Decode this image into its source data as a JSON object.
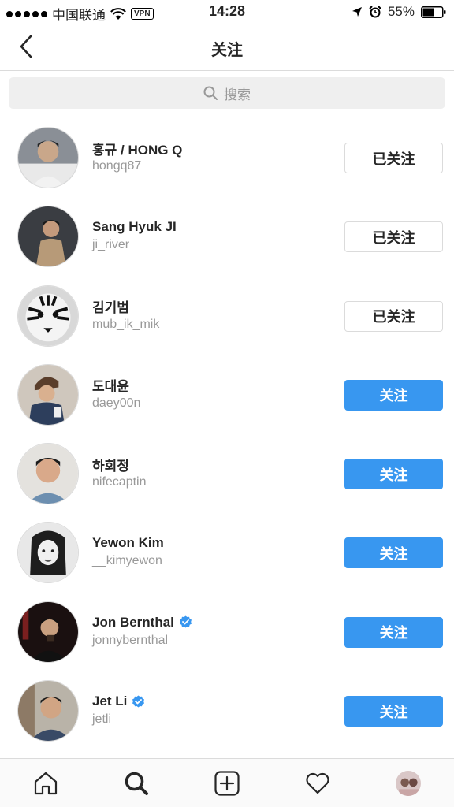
{
  "status_bar": {
    "carrier": "中国联通",
    "vpn": "VPN",
    "time": "14:28",
    "battery": "55%"
  },
  "nav": {
    "title": "关注"
  },
  "search": {
    "placeholder": "搜索"
  },
  "colors": {
    "accent": "#3897f0",
    "verified": "#3897f0"
  },
  "users": [
    {
      "name": "홍규 / HONG Q",
      "handle": "hongq87",
      "button": "已关注",
      "state": "following",
      "verified": false
    },
    {
      "name": "Sang Hyuk JI",
      "handle": "ji_river",
      "button": "已关注",
      "state": "following",
      "verified": false
    },
    {
      "name": "김기범",
      "handle": "mub_ik_mik",
      "button": "已关注",
      "state": "following",
      "verified": false
    },
    {
      "name": "도대윤",
      "handle": "daey00n",
      "button": "关注",
      "state": "follow",
      "verified": false
    },
    {
      "name": "하회정",
      "handle": "nifecaptin",
      "button": "关注",
      "state": "follow",
      "verified": false
    },
    {
      "name": "Yewon Kim",
      "handle": "__kimyewon",
      "button": "关注",
      "state": "follow",
      "verified": false
    },
    {
      "name": "Jon Bernthal",
      "handle": "jonnybernthal",
      "button": "关注",
      "state": "follow",
      "verified": true
    },
    {
      "name": "Jet Li",
      "handle": "jetli",
      "button": "关注",
      "state": "follow",
      "verified": true
    }
  ],
  "tab_bar": {
    "tabs": [
      "home-icon",
      "search-icon",
      "add-post-icon",
      "heart-icon",
      "profile-avatar"
    ]
  }
}
